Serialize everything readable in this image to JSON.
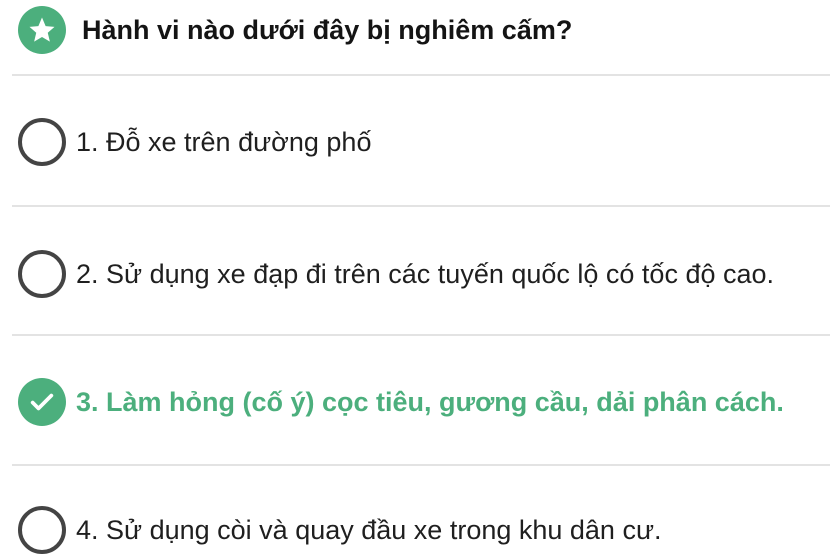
{
  "question": {
    "icon": "star-icon",
    "text": "Hành vi nào dưới đây bị nghiêm cấm?"
  },
  "options": [
    {
      "label": "1. Đỗ xe trên đường phố",
      "selected": false,
      "icon": "radio-unchecked-icon"
    },
    {
      "label": "2. Sử dụng xe đạp đi trên các tuyến quốc lộ có tốc độ cao.",
      "selected": false,
      "icon": "radio-unchecked-icon"
    },
    {
      "label": "3. Làm hỏng (cố ý) cọc tiêu, gương cầu, dải phân cách.",
      "selected": true,
      "icon": "check-circle-icon"
    },
    {
      "label": "4. Sử dụng còi và quay đầu xe trong khu dân cư.",
      "selected": false,
      "icon": "radio-unchecked-icon"
    }
  ],
  "colors": {
    "accent": "#4caf7d",
    "divider": "#e3e3e3",
    "text": "#1f1f1f",
    "radio_border": "#444444"
  }
}
